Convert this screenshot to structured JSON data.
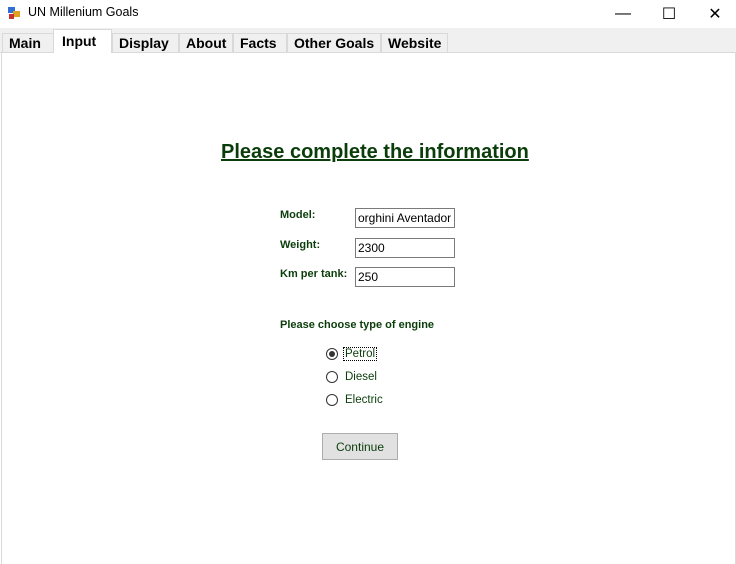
{
  "window": {
    "title": "UN Millenium Goals",
    "controls": {
      "minimize": "—",
      "maximize": "☐",
      "close": "✕"
    }
  },
  "tabs": [
    {
      "label": "Main",
      "active": false
    },
    {
      "label": "Input",
      "active": true
    },
    {
      "label": "Display",
      "active": false
    },
    {
      "label": "About",
      "active": false
    },
    {
      "label": "Facts",
      "active": false
    },
    {
      "label": "Other Goals",
      "active": false
    },
    {
      "label": "Website",
      "active": false
    }
  ],
  "form": {
    "heading": "Please complete the information",
    "model": {
      "label": "Model:",
      "value": "orghini Aventador S"
    },
    "weight": {
      "label": "Weight:",
      "value": "2300"
    },
    "km_per_tank": {
      "label": "Km per tank:",
      "value": "250"
    },
    "engine_prompt": "Please choose type of engine",
    "engine_options": [
      {
        "label": "Petrol",
        "checked": true
      },
      {
        "label": "Diesel",
        "checked": false
      },
      {
        "label": "Electric",
        "checked": false
      }
    ],
    "continue_label": "Continue"
  },
  "colors": {
    "text_green": "#0b3d0b",
    "tab_bg": "#f0f0f0",
    "button_bg": "#e1e1e1"
  }
}
